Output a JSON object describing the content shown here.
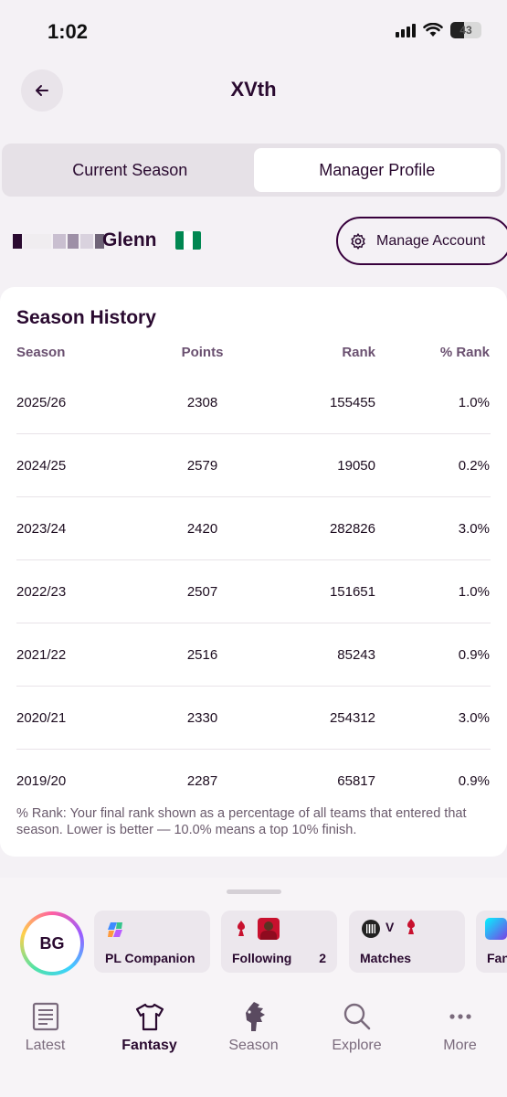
{
  "status_bar": {
    "time": "1:02",
    "battery": "43"
  },
  "header": {
    "title": "XVth"
  },
  "tabs": [
    {
      "label": "Current Season",
      "active": false
    },
    {
      "label": "Manager Profile",
      "active": true
    }
  ],
  "profile": {
    "name": "Glenn",
    "manage_label": "Manage Account"
  },
  "season_history": {
    "title": "Season History",
    "columns": [
      "Season",
      "Points",
      "Rank",
      "% Rank"
    ],
    "rows": [
      {
        "season": "2025/26",
        "points": "2308",
        "rank": "155455",
        "pct": "1.0%"
      },
      {
        "season": "2024/25",
        "points": "2579",
        "rank": "19050",
        "pct": "0.2%"
      },
      {
        "season": "2023/24",
        "points": "2420",
        "rank": "282826",
        "pct": "3.0%"
      },
      {
        "season": "2022/23",
        "points": "2507",
        "rank": "151651",
        "pct": "1.0%"
      },
      {
        "season": "2021/22",
        "points": "2516",
        "rank": "85243",
        "pct": "0.9%"
      },
      {
        "season": "2020/21",
        "points": "2330",
        "rank": "254312",
        "pct": "3.0%"
      },
      {
        "season": "2019/20",
        "points": "2287",
        "rank": "65817",
        "pct": "0.9%"
      }
    ],
    "footnote": "% Rank: Your final rank shown as a percentage of all teams that entered that season. Lower is better — 10.0% means a top 10% finish."
  },
  "shortcuts": {
    "avatar_initials": "BG",
    "items": [
      {
        "label": "PL Companion",
        "count": ""
      },
      {
        "label": "Following",
        "count": "2"
      },
      {
        "label": "Matches",
        "count": "",
        "versus": "V"
      },
      {
        "label": "Fan",
        "count": ""
      }
    ]
  },
  "nav": [
    {
      "label": "Latest",
      "icon": "newspaper-icon",
      "active": false
    },
    {
      "label": "Fantasy",
      "icon": "shirt-icon",
      "active": true
    },
    {
      "label": "Season",
      "icon": "lion-icon",
      "active": false
    },
    {
      "label": "Explore",
      "icon": "search-icon",
      "active": false
    },
    {
      "label": "More",
      "icon": "more-dots-icon",
      "active": false
    }
  ],
  "colors": {
    "primary": "#37003c",
    "background": "#f4f1f5",
    "card": "#ffffff",
    "nigeria_green": "#008751"
  }
}
